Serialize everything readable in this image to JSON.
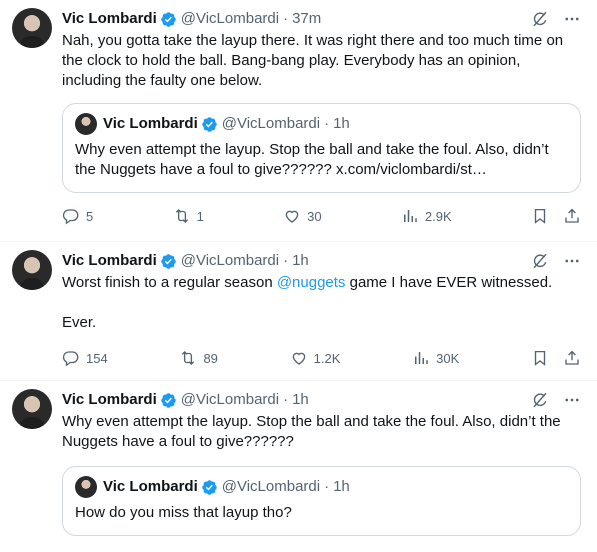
{
  "tweets": [
    {
      "name": "Vic Lombardi",
      "handle": "@VicLombardi",
      "sep": "·",
      "time": "37m",
      "text": "Nah, you gotta take the layup there. It was right there and too much time on the clock to hold the ball. Bang-bang play. Everybody has an opinion, including the faulty one below.",
      "quote": {
        "name": "Vic Lombardi",
        "handle": "@VicLombardi",
        "sep": "·",
        "time": "1h",
        "text": "Why even attempt the layup. Stop the ball and take the foul. Also, didn’t the Nuggets have a foul to give?????? x.com/viclombardi/st…"
      },
      "replies": "5",
      "reposts": "1",
      "likes": "30",
      "views": "2.9K"
    },
    {
      "name": "Vic Lombardi",
      "handle": "@VicLombardi",
      "sep": "·",
      "time": "1h",
      "text_before": "Worst finish to a regular season ",
      "mention": "@nuggets",
      "text_after": " game I have EVER witnessed.\n\nEver.",
      "replies": "154",
      "reposts": "89",
      "likes": "1.2K",
      "views": "30K"
    },
    {
      "name": "Vic Lombardi",
      "handle": "@VicLombardi",
      "sep": "·",
      "time": "1h",
      "text": "Why even attempt the layup. Stop the ball and take the foul. Also, didn’t the Nuggets have a foul to give??????",
      "quote": {
        "name": "Vic Lombardi",
        "handle": "@VicLombardi",
        "sep": "·",
        "time": "1h",
        "text": "How do you miss that layup tho?"
      }
    }
  ],
  "icons": {
    "verified": "verified-badge-icon",
    "grok": "grok-icon",
    "more": "more-icon",
    "reply": "reply-icon",
    "repost": "repost-icon",
    "like": "like-icon",
    "views": "views-icon",
    "bookmark": "bookmark-icon",
    "share": "share-icon"
  },
  "colors": {
    "accent": "#1d9bf0",
    "muted": "#536471",
    "text": "#0f1419",
    "border": "#cfd9de"
  }
}
